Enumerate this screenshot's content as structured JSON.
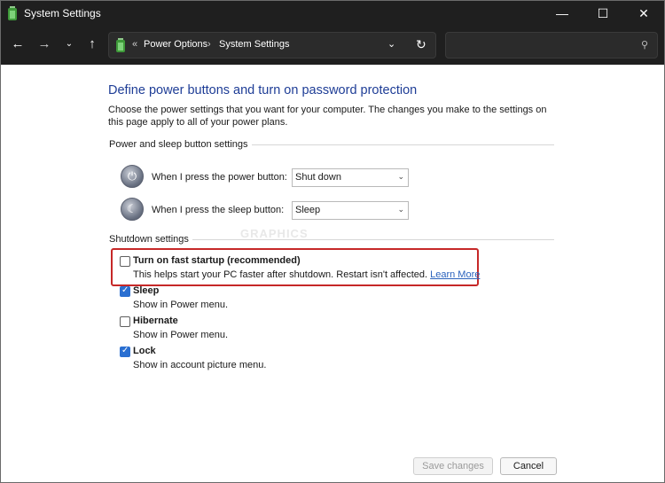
{
  "window": {
    "title": "System Settings",
    "minimize_glyph": "—",
    "maximize_glyph": "☐",
    "close_glyph": "✕"
  },
  "nav": {
    "back_glyph": "←",
    "forward_glyph": "→",
    "recent_glyph": "⌄",
    "up_glyph": "↑"
  },
  "address": {
    "chevrons": "«",
    "crumbs": [
      "Power Options",
      "System Settings"
    ],
    "separator": "›",
    "dropdown_glyph": "⌄",
    "refresh_glyph": "↻"
  },
  "search": {
    "placeholder": "",
    "icon_glyph": "⚲"
  },
  "page": {
    "title": "Define power buttons and turn on password protection",
    "description": "Choose the power settings that you want for your computer. The changes you make to the settings on this page apply to all of your power plans."
  },
  "power_group": {
    "title": "Power and sleep button settings",
    "power_row": {
      "label": "When I press the power button:",
      "value": "Shut down",
      "icon_glyph": "⏻"
    },
    "sleep_row": {
      "label": "When I press the sleep button:",
      "value": "Sleep",
      "icon_glyph": "☾"
    },
    "dropdown_glyph": "⌄"
  },
  "shutdown_group": {
    "title": "Shutdown settings",
    "check_glyph": "✓",
    "items": [
      {
        "label": "Turn on fast startup (recommended)",
        "desc": "This helps start your PC faster after shutdown. Restart isn't affected.",
        "link": "Learn More",
        "checked": false
      },
      {
        "label": "Sleep",
        "desc": "Show in Power menu.",
        "checked": true
      },
      {
        "label": "Hibernate",
        "desc": "Show in Power menu.",
        "checked": false
      },
      {
        "label": "Lock",
        "desc": "Show in account picture menu.",
        "checked": true
      }
    ]
  },
  "buttons": {
    "save": "Save changes",
    "cancel": "Cancel"
  },
  "colors": {
    "title_blue": "#1e3d96",
    "highlight_red": "#c62828",
    "checkbox_blue": "#2a6fd1"
  }
}
